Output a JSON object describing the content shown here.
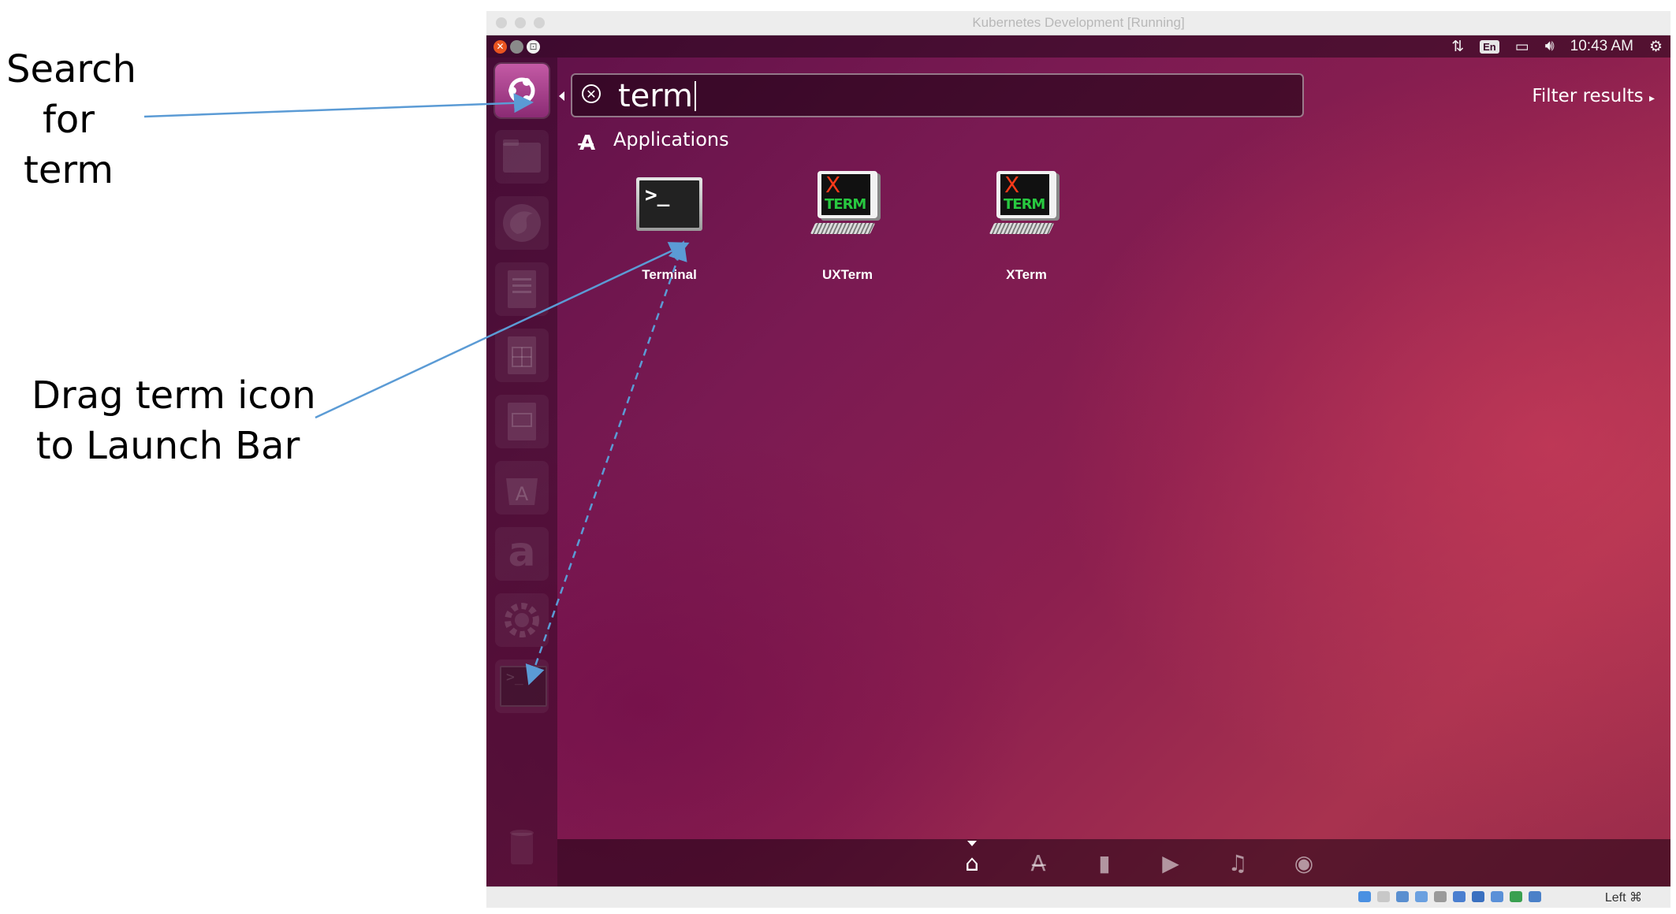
{
  "annotations": {
    "search": [
      "Search",
      "for",
      "term"
    ],
    "drag": [
      "Drag term icon",
      "to Launch Bar"
    ]
  },
  "window": {
    "title": "Kubernetes Development [Running]"
  },
  "top_panel": {
    "language": "En",
    "time": "10:43 AM"
  },
  "dash": {
    "search_query": "term",
    "filter_label": "Filter results",
    "category": "Applications",
    "apps": [
      {
        "name": "Terminal",
        "icon": "terminal-icon"
      },
      {
        "name": "UXTerm",
        "icon": "xterm-icon"
      },
      {
        "name": "XTerm",
        "icon": "xterm-icon"
      }
    ],
    "lenses": [
      "home-icon",
      "applications-icon",
      "files-icon",
      "video-icon",
      "music-icon",
      "photos-icon"
    ]
  },
  "launcher": {
    "items": [
      "ubuntu-dash-icon",
      "files-icon",
      "firefox-icon",
      "writer-icon",
      "calc-icon",
      "impress-icon",
      "software-center-icon",
      "amazon-icon",
      "settings-icon",
      "terminal-icon",
      "trash-icon"
    ],
    "amazon_letter": "a",
    "terminal_prompt": ">_"
  },
  "xterm_glyphs": {
    "x": "X",
    "term": "TERM"
  },
  "terminal_glyph": ">_",
  "vbox_statusbar": {
    "host_key": "Left ⌘"
  },
  "colors": {
    "arrow": "#5b9bd5",
    "desktop_primary": "#7a1a52",
    "close_button": "#e95420"
  }
}
